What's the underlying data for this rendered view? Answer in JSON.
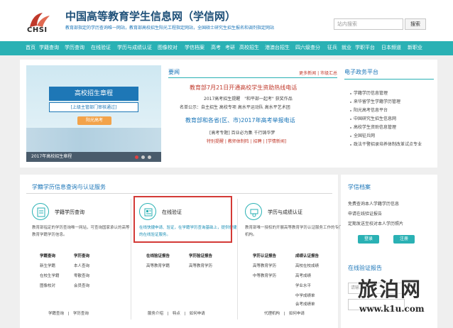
{
  "header": {
    "logo_text": "CHSI",
    "title": "中国高等教育学生信息网（学信网）",
    "subtitle": "教育部指定的学历查询唯一网站，教育部高校招生阳光工程指定网站，全国硕士研究生招生报名和调剂指定网站",
    "search_placeholder": "站内搜索",
    "search_button": "搜索"
  },
  "nav": [
    "首页",
    "学籍查询",
    "学历查询",
    "在线验证",
    "学历与成绩认证",
    "图像校对",
    "学信档案",
    "高考",
    "考研",
    "高校招生",
    "港澳台招生",
    "四六级查分",
    "征兵",
    "就业",
    "学职平台",
    "日本频道",
    "新职业"
  ],
  "banner": {
    "title": "高校招生章程",
    "subtitle": "[上级主管部门审核通过]",
    "button": "阳光高考",
    "caption": "2017年高校招生章程"
  },
  "news": {
    "title": "要闻",
    "links": "更多新闻 | 市级汇总",
    "lines": [
      "教育部7月21日开通高校学生资助热线电话",
      "2017高考招生提醒　\"和平部一起考\" 获奖作品",
      "名单公示：自主招生  高校专项  高水平运动队  高水平艺术团",
      "教育部和各省(区、市)2017年高考举报电话",
      "[高考专题] 百业必为集  千行铸华梦",
      "特别提醒 | 教师体制阵 | 招聘 | [学情新闻]"
    ]
  },
  "service": {
    "title": "电子政务平台",
    "items": [
      "学籍学历信息管理",
      "来华留学生学籍学历管理",
      "阳光高考信息平台",
      "中国研究生招生信息网",
      "高校学生资助信息管理",
      "全国征兵网",
      "政法干警招录培养体制改革试点专业"
    ]
  },
  "panel": {
    "title": "学籍学历信息查询与认证服务",
    "cards": [
      {
        "title": "学籍学历查询",
        "desc": "教育部指定的学历查询唯一网站，可查询国家承认的高等教育学籍学历信息。"
      },
      {
        "title": "在线验证",
        "desc": "在线快捷申请、验证，在学籍学历查询基础上，提供便捷的在线验证服务。"
      },
      {
        "title": "学历与成绩认证",
        "desc": "教育部唯一授权的开展高等教育学历认证服务工作的专门机构。"
      }
    ],
    "col1_head": [
      "学籍查询",
      "学历查询"
    ],
    "col1": [
      [
        "新生学籍",
        "本人查询"
      ],
      [
        "在校生学籍",
        "零散查询"
      ],
      [
        "图像校对",
        "会员查询"
      ]
    ],
    "col2_head": [
      "在线验证报告",
      "学历验证报告"
    ],
    "col2": [
      [
        "高等教育学籍",
        "高等教育学历"
      ]
    ],
    "col3_head": [
      "学历认证报告",
      "成绩认证报告"
    ],
    "col3": [
      [
        "高等教育学历",
        "高校在校成绩"
      ],
      [
        "中等教育学历",
        "高考成绩"
      ],
      [
        "",
        "学业水平"
      ],
      [
        "",
        "中学成绩单"
      ],
      [
        "",
        "会考成绩单"
      ]
    ],
    "bottom1": "学籍查询　|　学历查询",
    "bottom2": "服务介绍　|　特点　|　如何申请",
    "bottom3": "代理机构　|　如何申请"
  },
  "right_panel": {
    "title1": "学信档案",
    "items": [
      "免费查询本人学籍学历信息",
      "申请在线验证报告",
      "定期发送至校对本人学历照片"
    ],
    "register": "登录",
    "login": "注册",
    "title2": "在线验证报告",
    "input_placeholder": "请输入"
  },
  "watermark": {
    "main": "旅泊网",
    "sub": "www.k1u.com"
  },
  "colors": {
    "nav": "#2ab1b4",
    "title": "#1d4f78",
    "highlight": "#d43a36",
    "news_red": "#c0392b"
  }
}
